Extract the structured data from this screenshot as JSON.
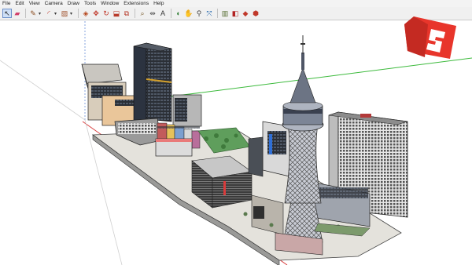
{
  "app": {
    "menu": [
      "File",
      "Edit",
      "View",
      "Camera",
      "Draw",
      "Tools",
      "Window",
      "Extensions",
      "Help"
    ]
  },
  "toolbar": {
    "tools": [
      {
        "name": "select-tool-icon",
        "glyph": "↖",
        "color": "#1f1f1f",
        "active": true
      },
      {
        "name": "eraser-tool-icon",
        "glyph": "▰",
        "color": "#d2426c"
      },
      {
        "name": "line-tool-icon",
        "glyph": "✎",
        "color": "#8a4b1e",
        "dropdown": true
      },
      {
        "name": "arc-tool-icon",
        "glyph": "◜",
        "color": "#c0392b",
        "dropdown": true
      },
      {
        "name": "shapes-tool-icon",
        "glyph": "▨",
        "color": "#a0522d",
        "dropdown": true
      },
      {
        "name": "push-pull-tool-icon",
        "glyph": "◈",
        "color": "#b5451b"
      },
      {
        "name": "move-tool-icon",
        "glyph": "✥",
        "color": "#c0392b"
      },
      {
        "name": "rotate-tool-icon",
        "glyph": "↻",
        "color": "#c0392b"
      },
      {
        "name": "scale-tool-icon",
        "glyph": "⬓",
        "color": "#b83a2a"
      },
      {
        "name": "offset-tool-icon",
        "glyph": "⧉",
        "color": "#b83a2a"
      },
      {
        "name": "tape-measure-tool-icon",
        "glyph": "⌕",
        "color": "#7a5a2a"
      },
      {
        "name": "dimension-tool-icon",
        "glyph": "⇹",
        "color": "#5a5a5a"
      },
      {
        "name": "text-tool-icon",
        "glyph": "A",
        "color": "#333333"
      },
      {
        "name": "orbit-tool-icon",
        "glyph": "◐",
        "color": "#2e7d32"
      },
      {
        "name": "pan-tool-icon",
        "glyph": "✋",
        "color": "#555555"
      },
      {
        "name": "zoom-tool-icon",
        "glyph": "⚲",
        "color": "#444444"
      },
      {
        "name": "zoom-extents-tool-icon",
        "glyph": "⤧",
        "color": "#2b6cb0"
      },
      {
        "name": "section-plane-tool-icon",
        "glyph": "▥",
        "color": "#556b2f"
      },
      {
        "name": "paint-bucket-tool-icon",
        "glyph": "◧",
        "color": "#b22222"
      },
      {
        "name": "components-tool-icon",
        "glyph": "◆",
        "color": "#c0392b"
      },
      {
        "name": "warehouse-tool-icon",
        "glyph": "⬢",
        "color": "#c0392b"
      }
    ]
  },
  "colors": {
    "axis_red": "#d83c3c",
    "axis_green": "#3cba3c",
    "logo_red": "#e8352b",
    "toolbar_bg": "#f0f0f0"
  }
}
